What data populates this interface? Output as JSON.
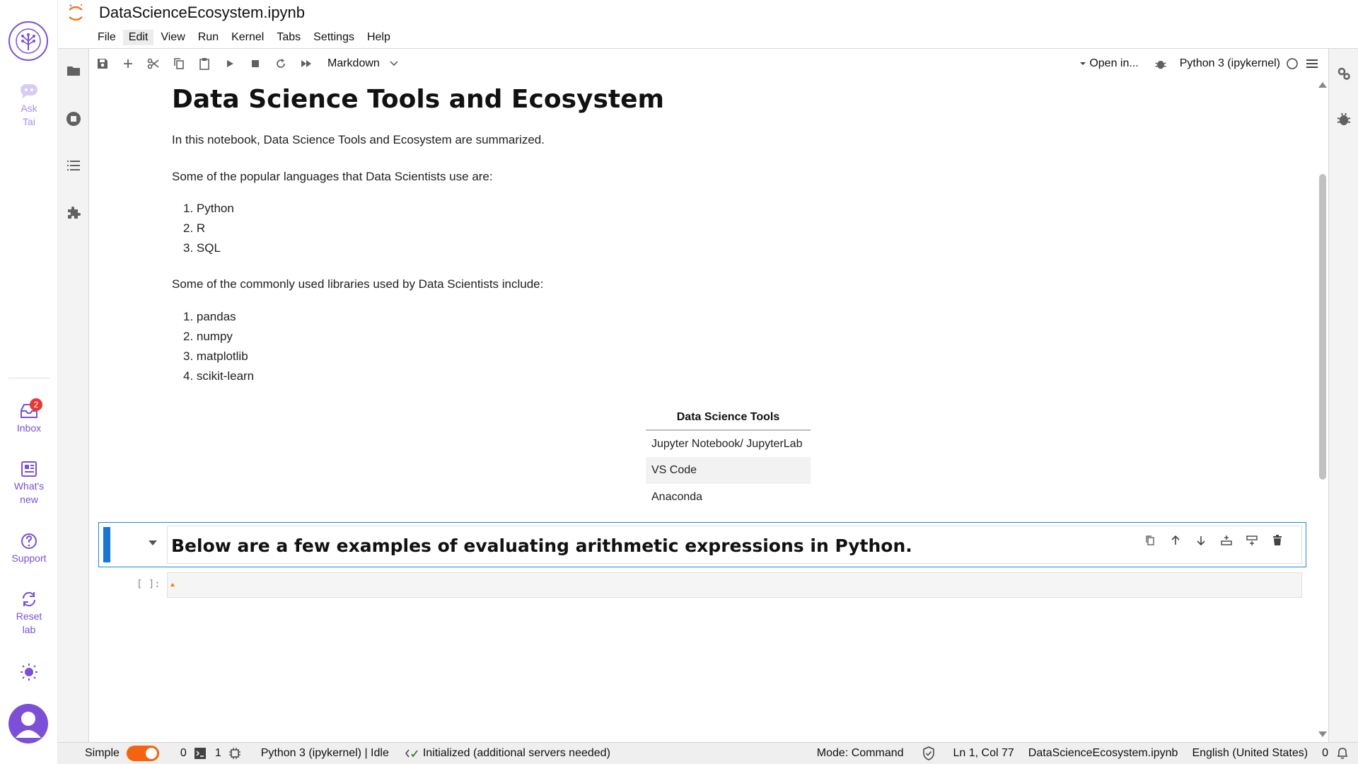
{
  "rail": {
    "ask_tai": "Ask Tai",
    "ask_line1": "Ask",
    "ask_line2": "Tai",
    "inbox": "Inbox",
    "inbox_badge": "2",
    "whats_new_line1": "What's",
    "whats_new_line2": "new",
    "support": "Support",
    "reset_line1": "Reset",
    "reset_line2": "lab",
    "accent": "#7b4fd6"
  },
  "document": {
    "title": "DataScienceEcosystem.ipynb"
  },
  "menu": [
    "File",
    "Edit",
    "View",
    "Run",
    "Kernel",
    "Tabs",
    "Settings",
    "Help"
  ],
  "menu_active": "Edit",
  "toolbar": {
    "cell_type": "Markdown",
    "open_in": "Open in...",
    "kernel": "Python 3 (ipykernel)"
  },
  "notebook": {
    "heading": "Data Science Tools and Ecosystem",
    "intro": "In this notebook, Data Science Tools and Ecosystem are summarized.",
    "languages_intro": "Some of the popular languages that Data Scientists use are:",
    "languages": [
      "1. Python",
      "2. R",
      "3. SQL"
    ],
    "libraries_intro": "Some of the commonly used libraries used by Data Scientists include:",
    "libraries": [
      "1. pandas",
      "2. numpy",
      "3. matplotlib",
      "4. scikit-learn"
    ],
    "table": {
      "header": "Data Science Tools",
      "rows": [
        "Jupyter Notebook/ JupyterLab",
        "VS Code",
        "Anaconda"
      ]
    },
    "active_cell_text": "Below are a few examples of evaluating arithmetic expressions in Python.",
    "code_prompt": "[ ]:"
  },
  "statusbar": {
    "mode_simple": "Simple",
    "terminals_count": "0",
    "kernels_count": "1",
    "kernel_status": "Python 3 (ipykernel) | Idle",
    "lsp_status": "Initialized (additional servers needed)",
    "mode": "Mode: Command",
    "cursor_pos": "Ln 1, Col 77",
    "filename": "DataScienceEcosystem.ipynb",
    "language": "English (United States)",
    "notifications": "0"
  }
}
